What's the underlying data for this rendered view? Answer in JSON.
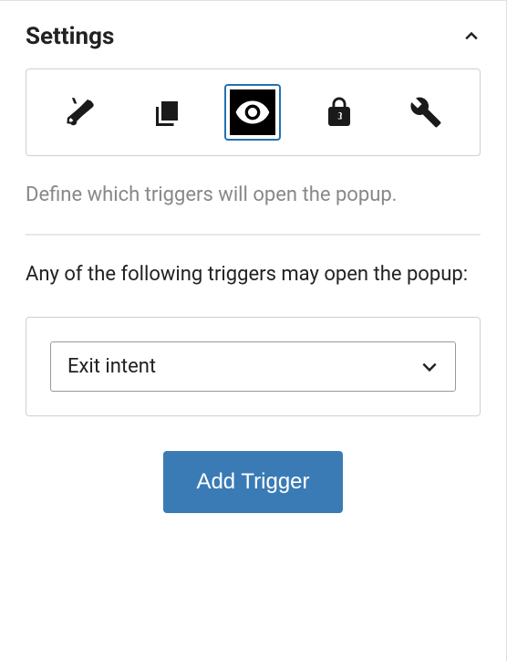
{
  "panel": {
    "title": "Settings",
    "tabs": [
      {
        "icon": "brush",
        "active": false
      },
      {
        "icon": "layers",
        "active": false
      },
      {
        "icon": "eye",
        "active": true
      },
      {
        "icon": "lock",
        "active": false
      },
      {
        "icon": "wrench",
        "active": false
      }
    ],
    "description": "Define which triggers will open the popup.",
    "triggers_label": "Any of the following triggers may open the popup:",
    "trigger_select": {
      "value": "Exit intent"
    },
    "add_button": "Add Trigger"
  }
}
